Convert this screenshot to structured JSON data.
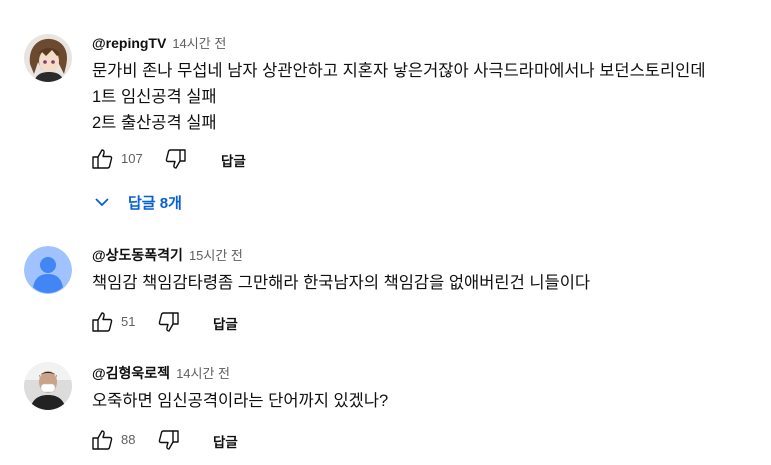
{
  "comments": [
    {
      "handle": "@repingTV",
      "time": "14시간 전",
      "lines": [
        "문가비 존나 무섭네 남자 상관안하고 지혼자 낳은거잖아 사극드라마에서나 보던스토리인데",
        "1트 임신공격 실패",
        "2트 출산공격 실패"
      ],
      "likes": "107",
      "reply_label": "답글",
      "replies_toggle": "답글 8개"
    },
    {
      "handle": "@상도동폭격기",
      "time": "15시간 전",
      "lines": [
        "책임감 책임감타령좀 그만해라 한국남자의 책임감을 없애버린건 니들이다"
      ],
      "likes": "51",
      "reply_label": "답글"
    },
    {
      "handle": "@김형욱로젝",
      "time": "14시간 전",
      "lines": [
        "오죽하면 임신공격이라는 단어까지 있겠나?"
      ],
      "likes": "88",
      "reply_label": "답글"
    }
  ],
  "colors": {
    "link": "#065fd4",
    "secondary": "#606060",
    "default_avatar": "#4285f4"
  },
  "icons": {
    "like": "thumb-up-icon",
    "dislike": "thumb-down-icon",
    "expand": "chevron-down-icon"
  }
}
